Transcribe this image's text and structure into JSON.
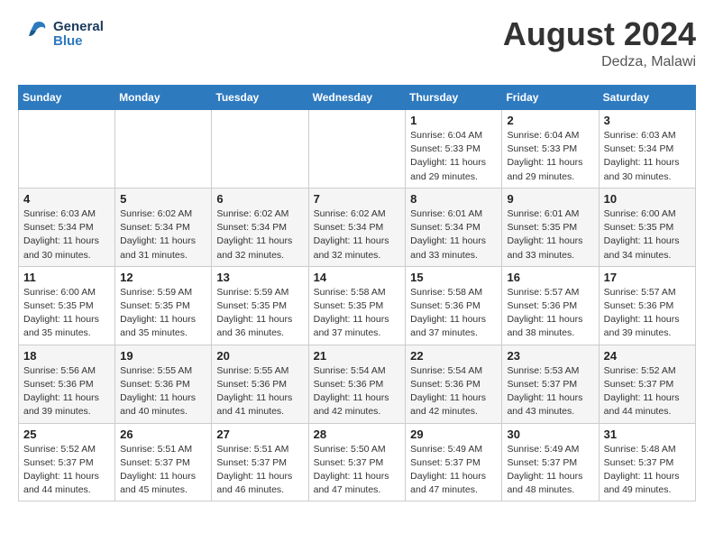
{
  "header": {
    "logo_line1": "General",
    "logo_line2": "Blue",
    "month_year": "August 2024",
    "location": "Dedza, Malawi"
  },
  "weekdays": [
    "Sunday",
    "Monday",
    "Tuesday",
    "Wednesday",
    "Thursday",
    "Friday",
    "Saturday"
  ],
  "weeks": [
    [
      {
        "day": "",
        "info": ""
      },
      {
        "day": "",
        "info": ""
      },
      {
        "day": "",
        "info": ""
      },
      {
        "day": "",
        "info": ""
      },
      {
        "day": "1",
        "info": "Sunrise: 6:04 AM\nSunset: 5:33 PM\nDaylight: 11 hours\nand 29 minutes."
      },
      {
        "day": "2",
        "info": "Sunrise: 6:04 AM\nSunset: 5:33 PM\nDaylight: 11 hours\nand 29 minutes."
      },
      {
        "day": "3",
        "info": "Sunrise: 6:03 AM\nSunset: 5:34 PM\nDaylight: 11 hours\nand 30 minutes."
      }
    ],
    [
      {
        "day": "4",
        "info": "Sunrise: 6:03 AM\nSunset: 5:34 PM\nDaylight: 11 hours\nand 30 minutes."
      },
      {
        "day": "5",
        "info": "Sunrise: 6:02 AM\nSunset: 5:34 PM\nDaylight: 11 hours\nand 31 minutes."
      },
      {
        "day": "6",
        "info": "Sunrise: 6:02 AM\nSunset: 5:34 PM\nDaylight: 11 hours\nand 32 minutes."
      },
      {
        "day": "7",
        "info": "Sunrise: 6:02 AM\nSunset: 5:34 PM\nDaylight: 11 hours\nand 32 minutes."
      },
      {
        "day": "8",
        "info": "Sunrise: 6:01 AM\nSunset: 5:34 PM\nDaylight: 11 hours\nand 33 minutes."
      },
      {
        "day": "9",
        "info": "Sunrise: 6:01 AM\nSunset: 5:35 PM\nDaylight: 11 hours\nand 33 minutes."
      },
      {
        "day": "10",
        "info": "Sunrise: 6:00 AM\nSunset: 5:35 PM\nDaylight: 11 hours\nand 34 minutes."
      }
    ],
    [
      {
        "day": "11",
        "info": "Sunrise: 6:00 AM\nSunset: 5:35 PM\nDaylight: 11 hours\nand 35 minutes."
      },
      {
        "day": "12",
        "info": "Sunrise: 5:59 AM\nSunset: 5:35 PM\nDaylight: 11 hours\nand 35 minutes."
      },
      {
        "day": "13",
        "info": "Sunrise: 5:59 AM\nSunset: 5:35 PM\nDaylight: 11 hours\nand 36 minutes."
      },
      {
        "day": "14",
        "info": "Sunrise: 5:58 AM\nSunset: 5:35 PM\nDaylight: 11 hours\nand 37 minutes."
      },
      {
        "day": "15",
        "info": "Sunrise: 5:58 AM\nSunset: 5:36 PM\nDaylight: 11 hours\nand 37 minutes."
      },
      {
        "day": "16",
        "info": "Sunrise: 5:57 AM\nSunset: 5:36 PM\nDaylight: 11 hours\nand 38 minutes."
      },
      {
        "day": "17",
        "info": "Sunrise: 5:57 AM\nSunset: 5:36 PM\nDaylight: 11 hours\nand 39 minutes."
      }
    ],
    [
      {
        "day": "18",
        "info": "Sunrise: 5:56 AM\nSunset: 5:36 PM\nDaylight: 11 hours\nand 39 minutes."
      },
      {
        "day": "19",
        "info": "Sunrise: 5:55 AM\nSunset: 5:36 PM\nDaylight: 11 hours\nand 40 minutes."
      },
      {
        "day": "20",
        "info": "Sunrise: 5:55 AM\nSunset: 5:36 PM\nDaylight: 11 hours\nand 41 minutes."
      },
      {
        "day": "21",
        "info": "Sunrise: 5:54 AM\nSunset: 5:36 PM\nDaylight: 11 hours\nand 42 minutes."
      },
      {
        "day": "22",
        "info": "Sunrise: 5:54 AM\nSunset: 5:36 PM\nDaylight: 11 hours\nand 42 minutes."
      },
      {
        "day": "23",
        "info": "Sunrise: 5:53 AM\nSunset: 5:37 PM\nDaylight: 11 hours\nand 43 minutes."
      },
      {
        "day": "24",
        "info": "Sunrise: 5:52 AM\nSunset: 5:37 PM\nDaylight: 11 hours\nand 44 minutes."
      }
    ],
    [
      {
        "day": "25",
        "info": "Sunrise: 5:52 AM\nSunset: 5:37 PM\nDaylight: 11 hours\nand 44 minutes."
      },
      {
        "day": "26",
        "info": "Sunrise: 5:51 AM\nSunset: 5:37 PM\nDaylight: 11 hours\nand 45 minutes."
      },
      {
        "day": "27",
        "info": "Sunrise: 5:51 AM\nSunset: 5:37 PM\nDaylight: 11 hours\nand 46 minutes."
      },
      {
        "day": "28",
        "info": "Sunrise: 5:50 AM\nSunset: 5:37 PM\nDaylight: 11 hours\nand 47 minutes."
      },
      {
        "day": "29",
        "info": "Sunrise: 5:49 AM\nSunset: 5:37 PM\nDaylight: 11 hours\nand 47 minutes."
      },
      {
        "day": "30",
        "info": "Sunrise: 5:49 AM\nSunset: 5:37 PM\nDaylight: 11 hours\nand 48 minutes."
      },
      {
        "day": "31",
        "info": "Sunrise: 5:48 AM\nSunset: 5:37 PM\nDaylight: 11 hours\nand 49 minutes."
      }
    ]
  ]
}
